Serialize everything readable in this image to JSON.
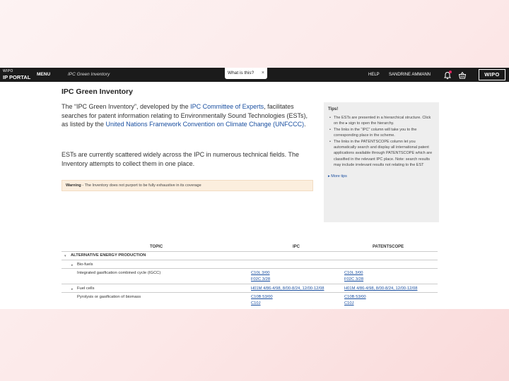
{
  "topbar": {
    "logo_small": "WIPO",
    "logo_big": "IP PORTAL",
    "menu": "MENU",
    "breadcrumb": "IPC Green Inventory",
    "whatis": "What is this?",
    "whatis_close": "×",
    "help": "HELP",
    "user": "SANDRINE AMMANN",
    "wipo": "WIPO"
  },
  "page": {
    "title": "IPC Green Inventory",
    "intro": {
      "t1": "The “IPC Green Inventory”, developed by the ",
      "l1": "IPC Committee of Experts",
      "t2": ", facilitates searches for patent information relating to Environmentally Sound Technologies (ESTs), as listed by the ",
      "l2": "United Nations Framework Convention on Climate Change (UNFCCC)",
      "t3": "."
    },
    "intro2": "ESTs are currently scattered widely across the IPC in numerous technical fields. The Inventory attempts to collect them in one place.",
    "warning_bold": "Warning",
    "warning_rest": " - The Inventory does not purport to be fully exhaustive in its coverage"
  },
  "tips": {
    "title": "Tips!",
    "items": [
      "The ESTs are presented in a hierarchical structure. Click on the ▸ sign to open the hierarchy.",
      "The links in the “IPC” column will take you to the corresponding place in the scheme.",
      "The links in the PATENTSCOPE column let you automatically search and display all international patent applications available through PATENTSCOPE which are classified in the relevant IPC place. Note: search results may include irrelevant results not relating to the EST"
    ],
    "more": "▸ More tips"
  },
  "table": {
    "headers": {
      "topic": "TOPIC",
      "ipc": "IPC",
      "patentscope": "PATENTSCOPE"
    },
    "section": "ALTERNATIVE ENERGY PRODUCTION",
    "rows": {
      "r1": {
        "topic": "Bio-fuels"
      },
      "r2": {
        "topic": "Integrated gasification combined cycle (IGCC)",
        "ipc1": "C10L 3/00",
        "ipc2": "F02C 3/28",
        "ps1": "C10L 3/00",
        "ps2": "F02C 3/28"
      },
      "r3": {
        "topic": "Fuel cells",
        "ipc1": "H01M 4/86-4/98, 8/00-8/24, 12/00-12/08",
        "ps1": "H01M 4/86-4/98, 8/00-8/24, 12/00-12/08"
      },
      "r4": {
        "topic": "Pyrolysis or gasification of biomass",
        "ipc1": "C10B 53/00",
        "ipc2": "C10J",
        "ps1": "C10B 53/00",
        "ps2": "C10J"
      }
    }
  },
  "colors": {
    "topbar": "#1b1b1b",
    "link": "#1a4fa0",
    "warning_bg": "#fbeede",
    "tips_bg": "#eeeeee"
  }
}
